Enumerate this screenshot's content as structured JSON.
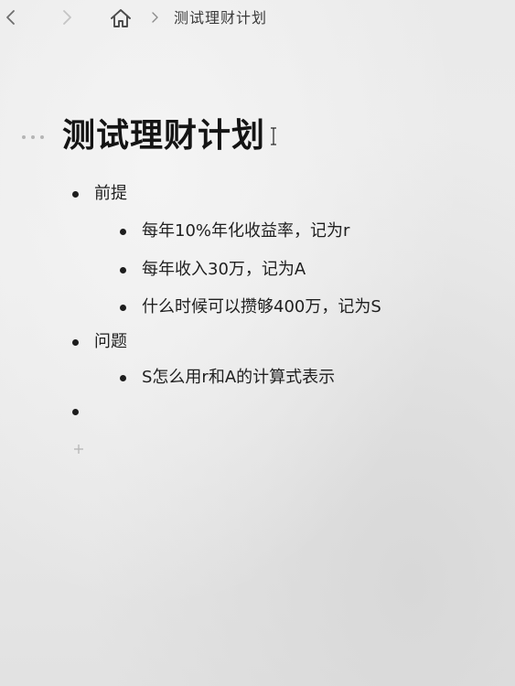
{
  "breadcrumb": {
    "back_icon": "chevron-left-icon",
    "forward_icon": "chevron-right-icon",
    "home_icon": "home-icon",
    "separator": "›",
    "page": "测试理财计划"
  },
  "page": {
    "title": "测试理财计划",
    "blocks": [
      {
        "level": 1,
        "text": "前提"
      },
      {
        "level": 2,
        "text": "每年10%年化收益率，记为r"
      },
      {
        "level": 2,
        "text": "每年收入30万，记为A"
      },
      {
        "level": 2,
        "text": "什么时候可以攒够400万，记为S"
      },
      {
        "level": 1,
        "text": "问题"
      },
      {
        "level": 2,
        "text": "S怎么用r和A的计算式表示"
      },
      {
        "level": 1,
        "text": ""
      }
    ],
    "add_icon": "plus-icon"
  },
  "colors": {
    "text": "#1c1c1c",
    "muted": "#b5b5b5",
    "background": "#e9e9e9"
  }
}
